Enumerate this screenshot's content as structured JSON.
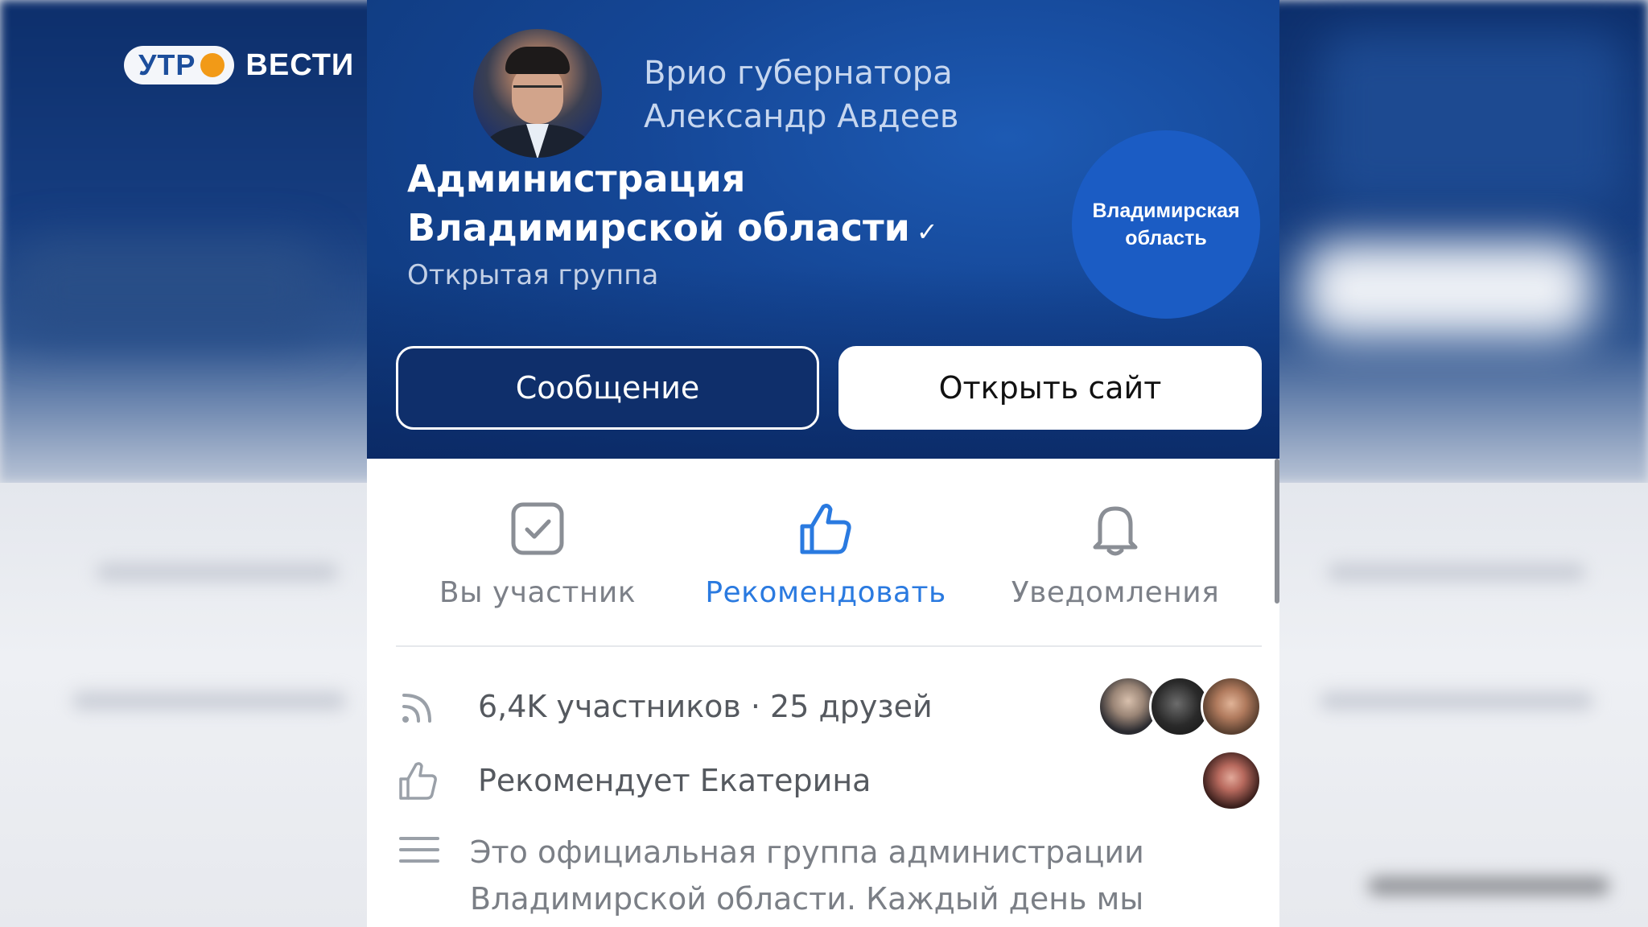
{
  "broadcast": {
    "logo_pill": "УТР",
    "logo_name": "ВЕСТИ"
  },
  "cover": {
    "subtitle_line1": "Врио губернатора",
    "subtitle_line2": "Александр Авдеев",
    "group_name_line1": "Администрация",
    "group_name_line2": "Владимирской области",
    "verified_mark": "✓",
    "group_type": "Открытая группа",
    "region_badge_line1": "Владимирская",
    "region_badge_line2": "область",
    "message_button": "Сообщение",
    "open_site_button": "Открыть сайт"
  },
  "actions": [
    {
      "label": "Вы участник",
      "icon": "checkbox-icon",
      "active": false
    },
    {
      "label": "Рекомендовать",
      "icon": "thumbs-up-icon",
      "active": true
    },
    {
      "label": "Уведомления",
      "icon": "bell-icon",
      "active": false
    }
  ],
  "info": {
    "members_text": "6,4K участников · 25 друзей",
    "members_icon": "rss-icon",
    "recommend_text": "Рекомендует Екатерина",
    "recommend_icon": "thumbs-up-icon",
    "description_icon": "text-lines-icon",
    "description_line1": "Это официальная группа администрации",
    "description_line2": "Владимирской области.  Каждый день мы"
  },
  "colors": {
    "cover_blue": "#154797",
    "badge_blue": "#1b5cc4",
    "accent_blue": "#2a7ae0",
    "logo_orange": "#f29a17"
  }
}
